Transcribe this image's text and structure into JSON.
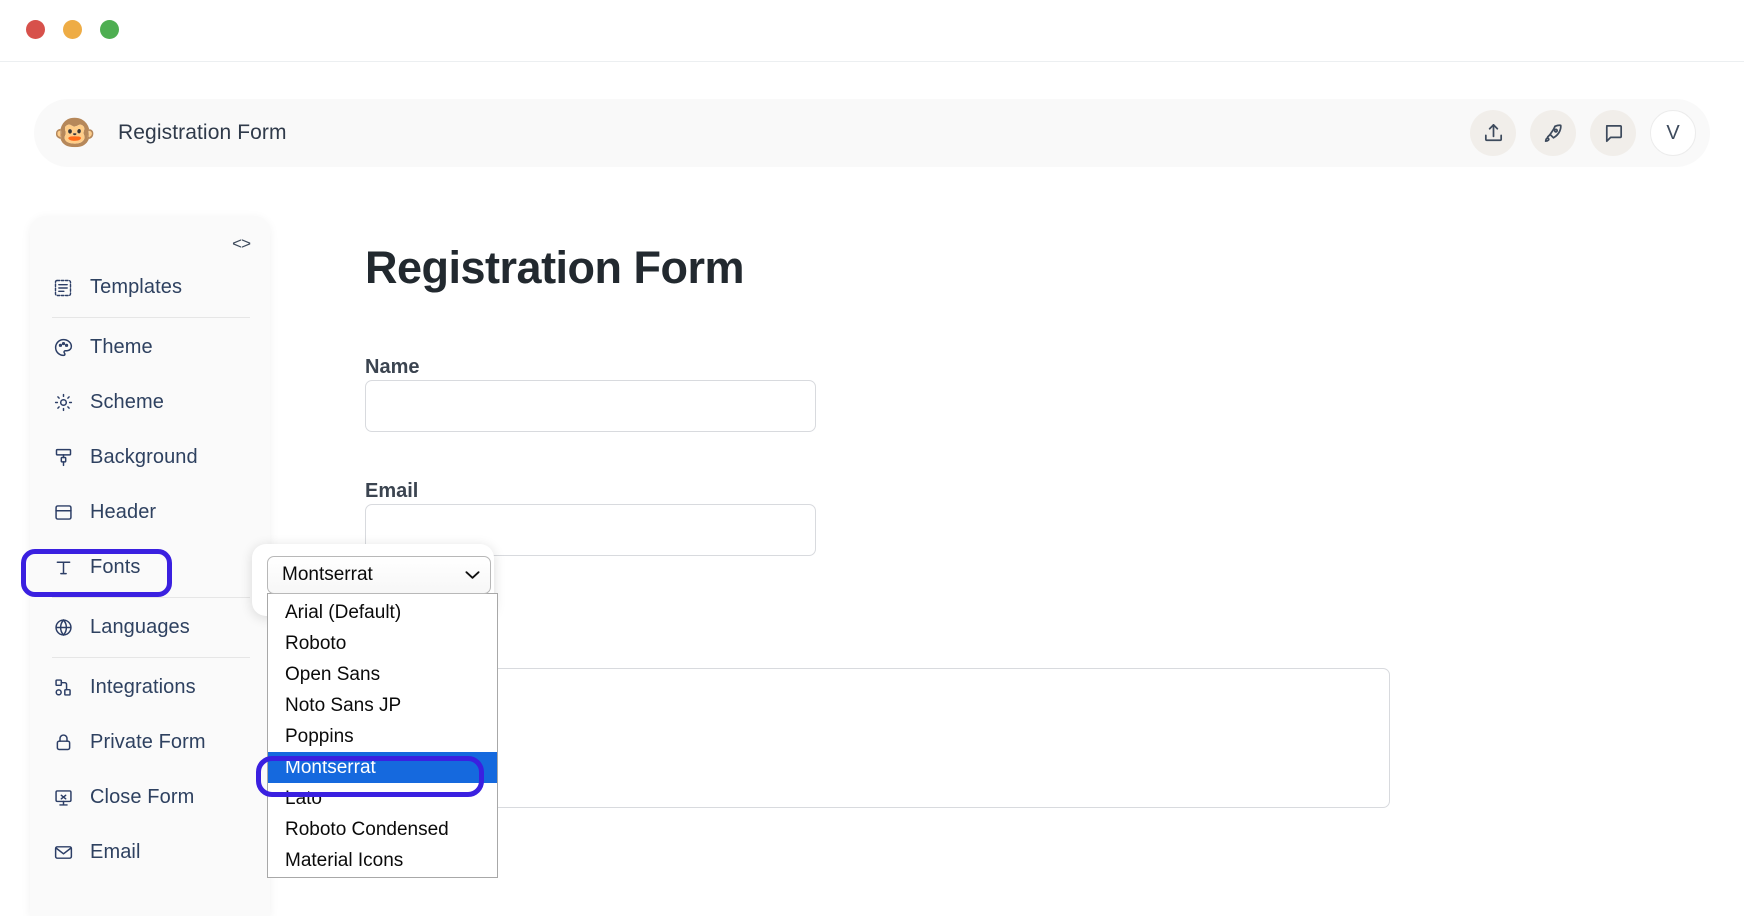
{
  "window": {
    "traffic_lights": [
      {
        "name": "close",
        "color": "#d7514b"
      },
      {
        "name": "minimize",
        "color": "#eeac45"
      },
      {
        "name": "maximize",
        "color": "#4eae51"
      }
    ]
  },
  "appbar": {
    "logo_glyph": "🐵",
    "title": "Registration Form",
    "actions": [
      {
        "name": "share-upload-icon",
        "icon": "upload"
      },
      {
        "name": "publish-rocket-icon",
        "icon": "rocket"
      },
      {
        "name": "comments-icon",
        "icon": "chat"
      }
    ],
    "avatar_initial": "V"
  },
  "sidebar": {
    "collapse_icon_label": "<>",
    "items": [
      {
        "label": "Templates",
        "icon": "templates",
        "separator_after": true
      },
      {
        "label": "Theme",
        "icon": "palette",
        "separator_after": false
      },
      {
        "label": "Scheme",
        "icon": "sun",
        "separator_after": false
      },
      {
        "label": "Background",
        "icon": "brush",
        "separator_after": false
      },
      {
        "label": "Header",
        "icon": "header",
        "separator_after": false
      },
      {
        "label": "Fonts",
        "icon": "text",
        "separator_after": true,
        "highlighted": true
      },
      {
        "label": "Languages",
        "icon": "globe",
        "separator_after": true
      },
      {
        "label": "Integrations",
        "icon": "nodes",
        "separator_after": false
      },
      {
        "label": "Private Form",
        "icon": "lock",
        "separator_after": false
      },
      {
        "label": "Close Form",
        "icon": "close-form",
        "separator_after": false
      },
      {
        "label": "Email",
        "icon": "envelope",
        "separator_after": false
      }
    ]
  },
  "form_preview": {
    "title": "Registration Form",
    "fields": [
      {
        "label": "Name",
        "value": "",
        "placeholder": ""
      },
      {
        "label": "Email",
        "value": "",
        "placeholder": ""
      }
    ],
    "message_value": "",
    "message_placeholder": ""
  },
  "font_setting": {
    "selected": "Montserrat",
    "options": [
      "Arial (Default)",
      "Roboto",
      "Open Sans",
      "Noto Sans JP",
      "Poppins",
      "Montserrat",
      "Lato",
      "Roboto Condensed",
      "Material Icons"
    ]
  },
  "annotations": {
    "color": "#3a20e0",
    "targets": [
      "sidebar-item-fonts",
      "option-montserrat"
    ]
  },
  "colors": {
    "selected_option_bg": "#1569de",
    "appbar_bg": "#f9f9f9",
    "sidebar_bg": "#fafafa",
    "nav_text": "#2e4160",
    "form_title": "#22292f"
  }
}
